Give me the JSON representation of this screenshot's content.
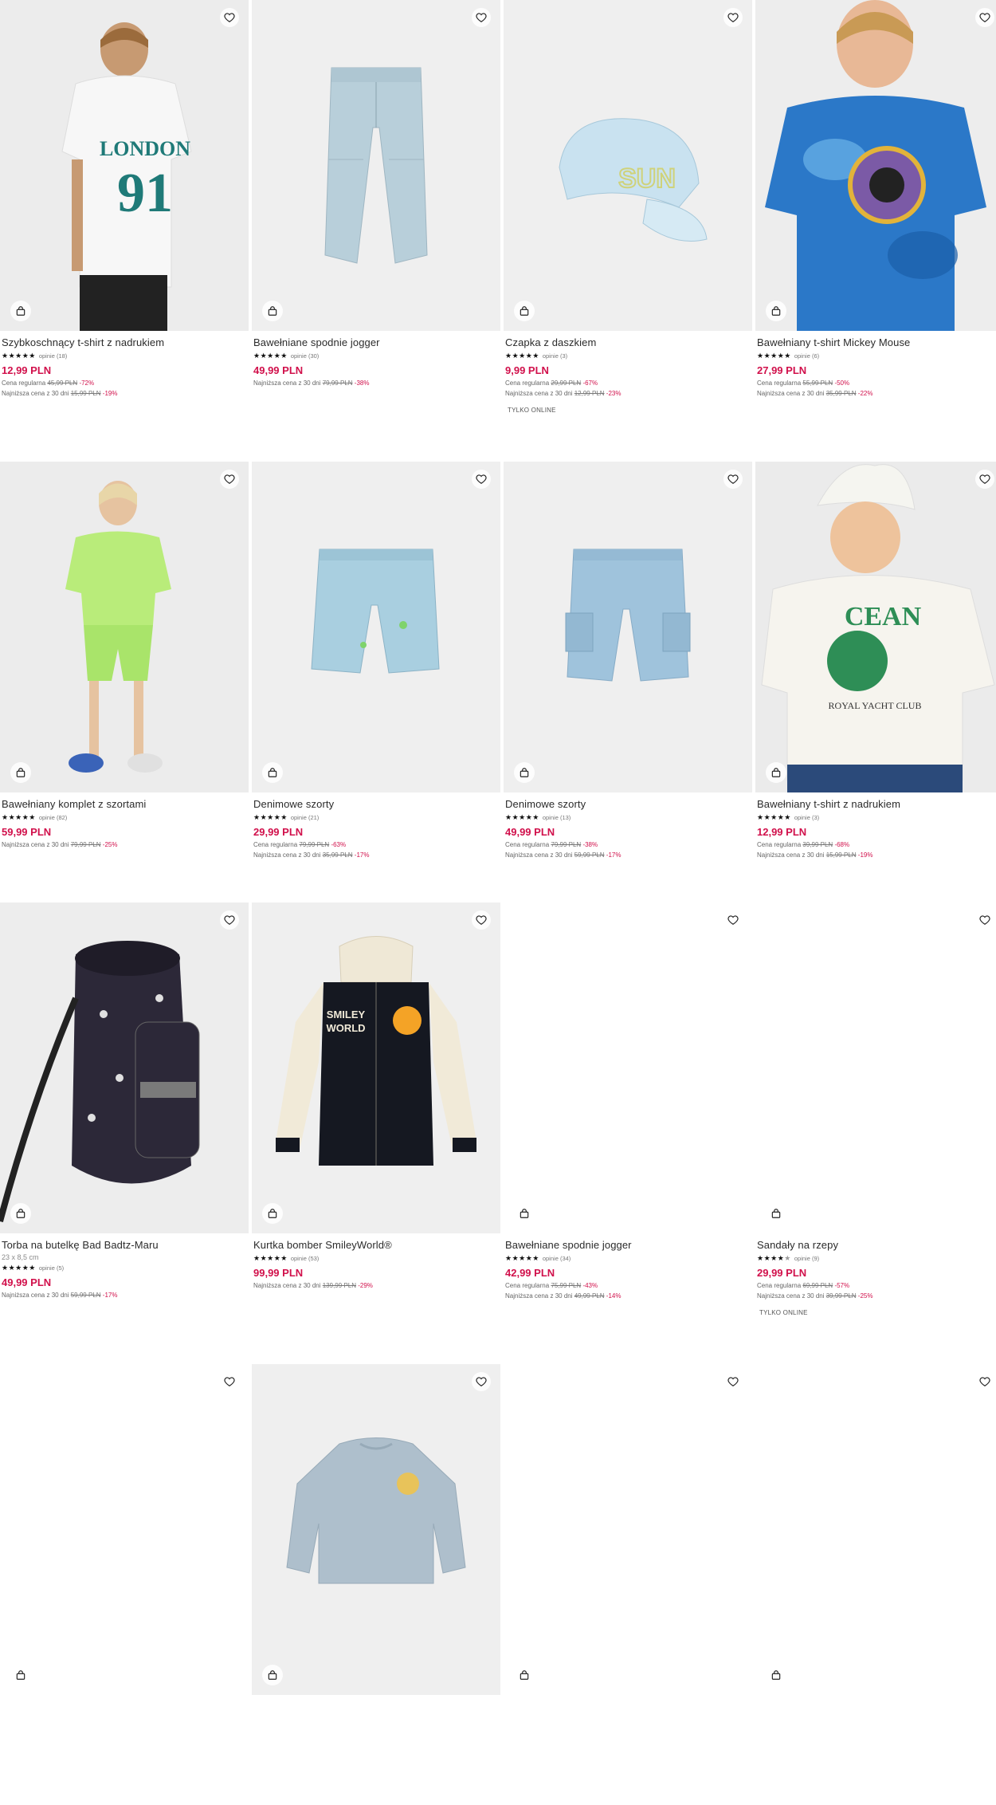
{
  "products": [
    {
      "name": "Szybkoschnący t-shirt z nadrukiem",
      "reviews": "opinie (18)",
      "price": "12,99 PLN",
      "regular_label": "Cena regularna",
      "regular_old": "45,99 PLN",
      "regular_disc": "-72%",
      "lowest_label": "Najniższa cena z 30 dni",
      "lowest_old": "15,99 PLN",
      "lowest_disc": "-19%"
    },
    {
      "name": "Bawełniane spodnie jogger",
      "reviews": "opinie (30)",
      "price": "49,99 PLN",
      "lowest_label": "Najniższa cena z 30 dni",
      "lowest_old": "79,99 PLN",
      "lowest_disc": "-38%"
    },
    {
      "name": "Czapka z daszkiem",
      "reviews": "opinie (3)",
      "price": "9,99 PLN",
      "regular_label": "Cena regularna",
      "regular_old": "29,99 PLN",
      "regular_disc": "-67%",
      "lowest_label": "Najniższa cena z 30 dni",
      "lowest_old": "12,99 PLN",
      "lowest_disc": "-23%",
      "online": "TYLKO ONLINE"
    },
    {
      "name": "Bawełniany t-shirt Mickey Mouse",
      "reviews": "opinie (6)",
      "price": "27,99 PLN",
      "regular_label": "Cena regularna",
      "regular_old": "55,99 PLN",
      "regular_disc": "-50%",
      "lowest_label": "Najniższa cena z 30 dni",
      "lowest_old": "35,99 PLN",
      "lowest_disc": "-22%"
    },
    {
      "name": "Bawełniany komplet z szortami",
      "reviews": "opinie (82)",
      "price": "59,99 PLN",
      "lowest_label": "Najniższa cena z 30 dni",
      "lowest_old": "79,99 PLN",
      "lowest_disc": "-25%"
    },
    {
      "name": "Denimowe szorty",
      "reviews": "opinie (21)",
      "price": "29,99 PLN",
      "regular_label": "Cena regularna",
      "regular_old": "79,99 PLN",
      "regular_disc": "-63%",
      "lowest_label": "Najniższa cena z 30 dni",
      "lowest_old": "35,99 PLN",
      "lowest_disc": "-17%"
    },
    {
      "name": "Denimowe szorty",
      "reviews": "opinie (13)",
      "price": "49,99 PLN",
      "regular_label": "Cena regularna",
      "regular_old": "79,99 PLN",
      "regular_disc": "-38%",
      "lowest_label": "Najniższa cena z 30 dni",
      "lowest_old": "59,99 PLN",
      "lowest_disc": "-17%"
    },
    {
      "name": "Bawełniany t-shirt z nadrukiem",
      "reviews": "opinie (3)",
      "price": "12,99 PLN",
      "regular_label": "Cena regularna",
      "regular_old": "39,99 PLN",
      "regular_disc": "-68%",
      "lowest_label": "Najniższa cena z 30 dni",
      "lowest_old": "15,99 PLN",
      "lowest_disc": "-19%"
    },
    {
      "name": "Torba na butelkę Bad Badtz-Maru",
      "size": "23 x 8,5 cm",
      "reviews": "opinie (5)",
      "price": "49,99 PLN",
      "lowest_label": "Najniższa cena z 30 dni",
      "lowest_old": "59,99 PLN",
      "lowest_disc": "-17%"
    },
    {
      "name": "Kurtka bomber SmileyWorld®",
      "reviews": "opinie (53)",
      "price": "99,99 PLN",
      "lowest_label": "Najniższa cena z 30 dni",
      "lowest_old": "139,99 PLN",
      "lowest_disc": "-29%"
    },
    {
      "name": "Bawełniane spodnie jogger",
      "reviews": "opinie (34)",
      "price": "42,99 PLN",
      "regular_label": "Cena regularna",
      "regular_old": "75,99 PLN",
      "regular_disc": "-43%",
      "lowest_label": "Najniższa cena z 30 dni",
      "lowest_old": "49,99 PLN",
      "lowest_disc": "-14%"
    },
    {
      "name": "Sandały na rzepy",
      "reviews": "opinie (9)",
      "price": "29,99 PLN",
      "regular_label": "Cena regularna",
      "regular_old": "69,99 PLN",
      "regular_disc": "-57%",
      "lowest_label": "Najniższa cena z 30 dni",
      "lowest_old": "39,99 PLN",
      "lowest_disc": "-25%",
      "online": "TYLKO ONLINE",
      "half_star": true
    },
    {
      "name": ""
    },
    {
      "name": ""
    },
    {
      "name": ""
    },
    {
      "name": ""
    }
  ],
  "colors": {
    "price": "#d1104b",
    "image_bg": "#f0f0f0",
    "text": "#2b2b2b"
  },
  "icons": {
    "favorite": "heart-icon",
    "add_to_cart": "shopping-bag-icon",
    "rating": "star-icon"
  }
}
